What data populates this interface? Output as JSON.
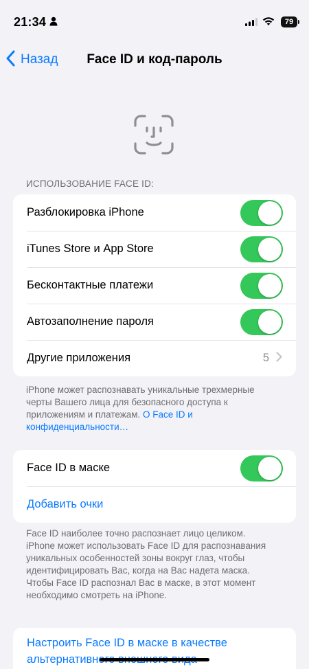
{
  "status_bar": {
    "time": "21:34",
    "battery": "79",
    "icons": [
      "person-icon",
      "signal-icon",
      "wifi-icon",
      "battery-icon"
    ]
  },
  "nav": {
    "back_label": "Назад",
    "title": "Face ID и код-пароль"
  },
  "section_usage": {
    "header": "ИСПОЛЬЗОВАНИЕ FACE ID:",
    "rows": [
      {
        "label": "Разблокировка iPhone",
        "toggle_on": true
      },
      {
        "label": "iTunes Store и App Store",
        "toggle_on": true
      },
      {
        "label": "Бесконтактные платежи",
        "toggle_on": true
      },
      {
        "label": "Автозаполнение пароля",
        "toggle_on": true
      },
      {
        "label": "Другие приложения",
        "value": "5"
      }
    ],
    "footer_text": "iPhone может распознавать уникальные трехмерные черты Вашего лица для безопасного доступа к приложениям и платежам. ",
    "footer_link": "О Face ID и конфиденциальности…"
  },
  "section_mask": {
    "rows": [
      {
        "label": "Face ID в маске",
        "toggle_on": true
      },
      {
        "label": "Добавить очки"
      }
    ],
    "footer_text": "Face ID наиболее точно распознает лицо целиком. iPhone может использовать Face ID для распознавания уникальных особенностей зоны вокруг глаз, чтобы идентифицировать Вас, когда на Вас надета маска. Чтобы Face ID распознал Вас в маске, в этот момент необходимо смотреть на iPhone."
  },
  "section_alt": {
    "link_text": "Настроить Face ID в маске в качестве альтернативного внешнего вида"
  },
  "colors": {
    "accent": "#0a7aff",
    "toggle_on": "#34c759",
    "background": "#f2f2f7"
  }
}
